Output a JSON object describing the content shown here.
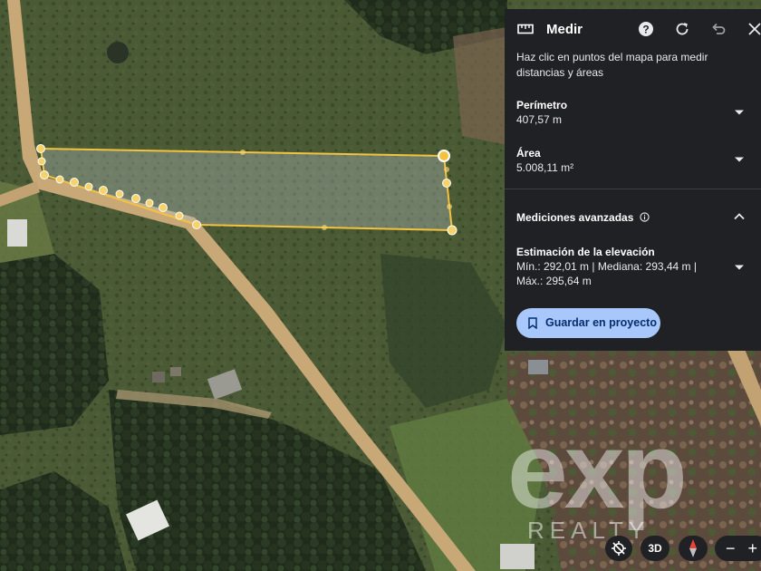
{
  "panel": {
    "title": "Medir",
    "instructions": "Haz clic en puntos del mapa para medir distancias y áreas",
    "perimeter_label": "Perímetro",
    "perimeter_value": "407,57 m",
    "area_label": "Área",
    "area_value": "5.008,11 m²",
    "advanced_label": "Mediciones avanzadas",
    "elevation_label": "Estimación de la elevación",
    "elevation_line1": "Mín.: 292,01 m | Mediana: 293,44 m |",
    "elevation_line2": "Máx.: 295,64 m",
    "save_label": "Guardar en proyecto"
  },
  "map_controls": {
    "view_3d_label": "3D",
    "zoom_out": "−",
    "zoom_in": "+"
  },
  "watermark": {
    "brand": "exp",
    "subtitle": "REALTY"
  },
  "colors": {
    "panel_bg": "#202124",
    "accent_button": "#a8c7fa",
    "polygon_outline": "#f3c23f"
  },
  "icons": [
    "ruler-icon",
    "help-icon",
    "reset-icon",
    "undo-icon",
    "close-icon",
    "chevron-down-icon",
    "chevron-up-icon",
    "info-icon",
    "bookmark-icon",
    "recenter-off-icon",
    "compass-icon"
  ]
}
